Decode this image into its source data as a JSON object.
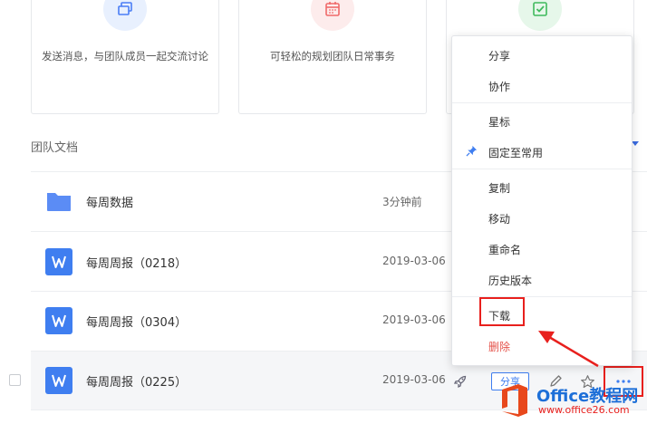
{
  "cards": [
    {
      "text": "发送消息，与团队成员一起交流讨论",
      "icon": "chat-icon",
      "icon_bg": "#e8f0fe",
      "icon_color": "#4a7ef5"
    },
    {
      "text": "可轻松的规划团队日常事务",
      "icon": "calendar-icon",
      "icon_bg": "#fdecec",
      "icon_color": "#f06a6a"
    },
    {
      "text": "",
      "icon": "task-check-icon",
      "icon_bg": "#e6f7ea",
      "icon_color": "#3fba5c"
    }
  ],
  "section": {
    "title": "团队文档"
  },
  "files": [
    {
      "name": "每周数据",
      "date": "3分钟前",
      "type": "folder"
    },
    {
      "name": "每周周报（0218）",
      "date": "2019-03-06",
      "type": "word"
    },
    {
      "name": "每周周报（0304）",
      "date": "2019-03-06",
      "type": "word"
    },
    {
      "name": "每周周报（0225）",
      "date": "2019-03-06",
      "type": "word"
    }
  ],
  "row_actions": {
    "share_label": "分享"
  },
  "context_menu": {
    "items": [
      {
        "label": "分享"
      },
      {
        "label": "协作"
      },
      {
        "label": "星标"
      },
      {
        "label": "固定至常用"
      },
      {
        "label": "复制"
      },
      {
        "label": "移动"
      },
      {
        "label": "重命名"
      },
      {
        "label": "历史版本"
      },
      {
        "label": "下载"
      },
      {
        "label": "删除"
      }
    ]
  },
  "watermark": {
    "title": "Office教程网",
    "url": "www.office26.com"
  },
  "colors": {
    "accent": "#3f7ef0",
    "danger": "#e5534b",
    "highlight": "#e8201d"
  }
}
